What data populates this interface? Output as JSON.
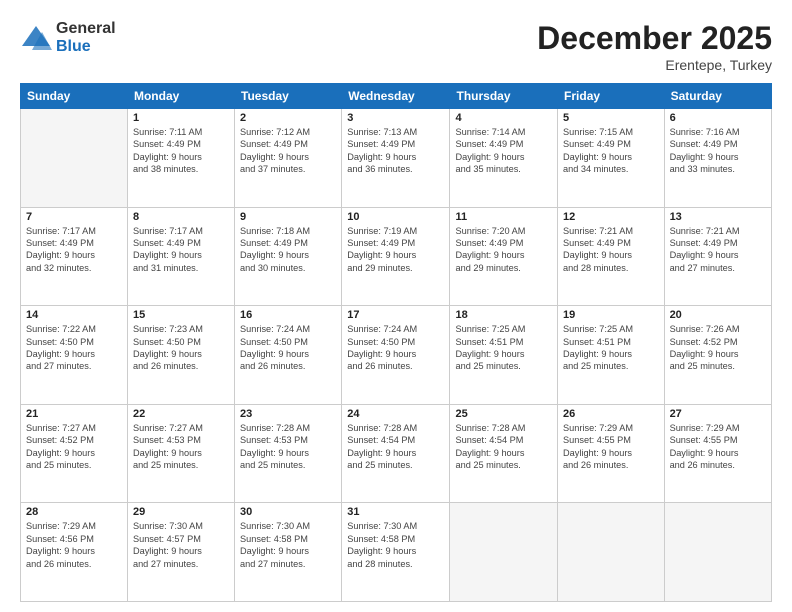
{
  "header": {
    "logo_general": "General",
    "logo_blue": "Blue",
    "month_title": "December 2025",
    "subtitle": "Erentepe, Turkey"
  },
  "days_of_week": [
    "Sunday",
    "Monday",
    "Tuesday",
    "Wednesday",
    "Thursday",
    "Friday",
    "Saturday"
  ],
  "weeks": [
    [
      {
        "day": "",
        "info": ""
      },
      {
        "day": "1",
        "info": "Sunrise: 7:11 AM\nSunset: 4:49 PM\nDaylight: 9 hours\nand 38 minutes."
      },
      {
        "day": "2",
        "info": "Sunrise: 7:12 AM\nSunset: 4:49 PM\nDaylight: 9 hours\nand 37 minutes."
      },
      {
        "day": "3",
        "info": "Sunrise: 7:13 AM\nSunset: 4:49 PM\nDaylight: 9 hours\nand 36 minutes."
      },
      {
        "day": "4",
        "info": "Sunrise: 7:14 AM\nSunset: 4:49 PM\nDaylight: 9 hours\nand 35 minutes."
      },
      {
        "day": "5",
        "info": "Sunrise: 7:15 AM\nSunset: 4:49 PM\nDaylight: 9 hours\nand 34 minutes."
      },
      {
        "day": "6",
        "info": "Sunrise: 7:16 AM\nSunset: 4:49 PM\nDaylight: 9 hours\nand 33 minutes."
      }
    ],
    [
      {
        "day": "7",
        "info": "Sunrise: 7:17 AM\nSunset: 4:49 PM\nDaylight: 9 hours\nand 32 minutes."
      },
      {
        "day": "8",
        "info": "Sunrise: 7:17 AM\nSunset: 4:49 PM\nDaylight: 9 hours\nand 31 minutes."
      },
      {
        "day": "9",
        "info": "Sunrise: 7:18 AM\nSunset: 4:49 PM\nDaylight: 9 hours\nand 30 minutes."
      },
      {
        "day": "10",
        "info": "Sunrise: 7:19 AM\nSunset: 4:49 PM\nDaylight: 9 hours\nand 29 minutes."
      },
      {
        "day": "11",
        "info": "Sunrise: 7:20 AM\nSunset: 4:49 PM\nDaylight: 9 hours\nand 29 minutes."
      },
      {
        "day": "12",
        "info": "Sunrise: 7:21 AM\nSunset: 4:49 PM\nDaylight: 9 hours\nand 28 minutes."
      },
      {
        "day": "13",
        "info": "Sunrise: 7:21 AM\nSunset: 4:49 PM\nDaylight: 9 hours\nand 27 minutes."
      }
    ],
    [
      {
        "day": "14",
        "info": "Sunrise: 7:22 AM\nSunset: 4:50 PM\nDaylight: 9 hours\nand 27 minutes."
      },
      {
        "day": "15",
        "info": "Sunrise: 7:23 AM\nSunset: 4:50 PM\nDaylight: 9 hours\nand 26 minutes."
      },
      {
        "day": "16",
        "info": "Sunrise: 7:24 AM\nSunset: 4:50 PM\nDaylight: 9 hours\nand 26 minutes."
      },
      {
        "day": "17",
        "info": "Sunrise: 7:24 AM\nSunset: 4:50 PM\nDaylight: 9 hours\nand 26 minutes."
      },
      {
        "day": "18",
        "info": "Sunrise: 7:25 AM\nSunset: 4:51 PM\nDaylight: 9 hours\nand 25 minutes."
      },
      {
        "day": "19",
        "info": "Sunrise: 7:25 AM\nSunset: 4:51 PM\nDaylight: 9 hours\nand 25 minutes."
      },
      {
        "day": "20",
        "info": "Sunrise: 7:26 AM\nSunset: 4:52 PM\nDaylight: 9 hours\nand 25 minutes."
      }
    ],
    [
      {
        "day": "21",
        "info": "Sunrise: 7:27 AM\nSunset: 4:52 PM\nDaylight: 9 hours\nand 25 minutes."
      },
      {
        "day": "22",
        "info": "Sunrise: 7:27 AM\nSunset: 4:53 PM\nDaylight: 9 hours\nand 25 minutes."
      },
      {
        "day": "23",
        "info": "Sunrise: 7:28 AM\nSunset: 4:53 PM\nDaylight: 9 hours\nand 25 minutes."
      },
      {
        "day": "24",
        "info": "Sunrise: 7:28 AM\nSunset: 4:54 PM\nDaylight: 9 hours\nand 25 minutes."
      },
      {
        "day": "25",
        "info": "Sunrise: 7:28 AM\nSunset: 4:54 PM\nDaylight: 9 hours\nand 25 minutes."
      },
      {
        "day": "26",
        "info": "Sunrise: 7:29 AM\nSunset: 4:55 PM\nDaylight: 9 hours\nand 26 minutes."
      },
      {
        "day": "27",
        "info": "Sunrise: 7:29 AM\nSunset: 4:55 PM\nDaylight: 9 hours\nand 26 minutes."
      }
    ],
    [
      {
        "day": "28",
        "info": "Sunrise: 7:29 AM\nSunset: 4:56 PM\nDaylight: 9 hours\nand 26 minutes."
      },
      {
        "day": "29",
        "info": "Sunrise: 7:30 AM\nSunset: 4:57 PM\nDaylight: 9 hours\nand 27 minutes."
      },
      {
        "day": "30",
        "info": "Sunrise: 7:30 AM\nSunset: 4:58 PM\nDaylight: 9 hours\nand 27 minutes."
      },
      {
        "day": "31",
        "info": "Sunrise: 7:30 AM\nSunset: 4:58 PM\nDaylight: 9 hours\nand 28 minutes."
      },
      {
        "day": "",
        "info": ""
      },
      {
        "day": "",
        "info": ""
      },
      {
        "day": "",
        "info": ""
      }
    ]
  ]
}
